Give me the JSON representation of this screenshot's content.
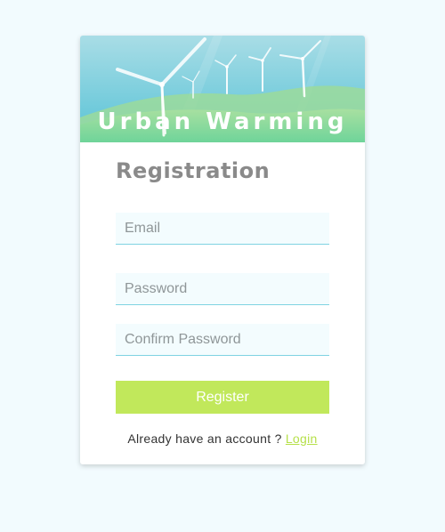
{
  "banner": {
    "title": "Urban Warming",
    "image": "wind-turbines-landscape"
  },
  "form": {
    "heading": "Registration",
    "email_placeholder": "Email",
    "password_placeholder": "Password",
    "confirm_password_placeholder": "Confirm Password",
    "register_label": "Register"
  },
  "footer": {
    "prompt_text": "Already have an account ? ",
    "login_label": "Login"
  },
  "colors": {
    "page_background": "#f2fbfe",
    "accent_green": "#c1e85b",
    "field_underline": "#7fd3e2",
    "heading_gray": "#8a8a8a"
  }
}
